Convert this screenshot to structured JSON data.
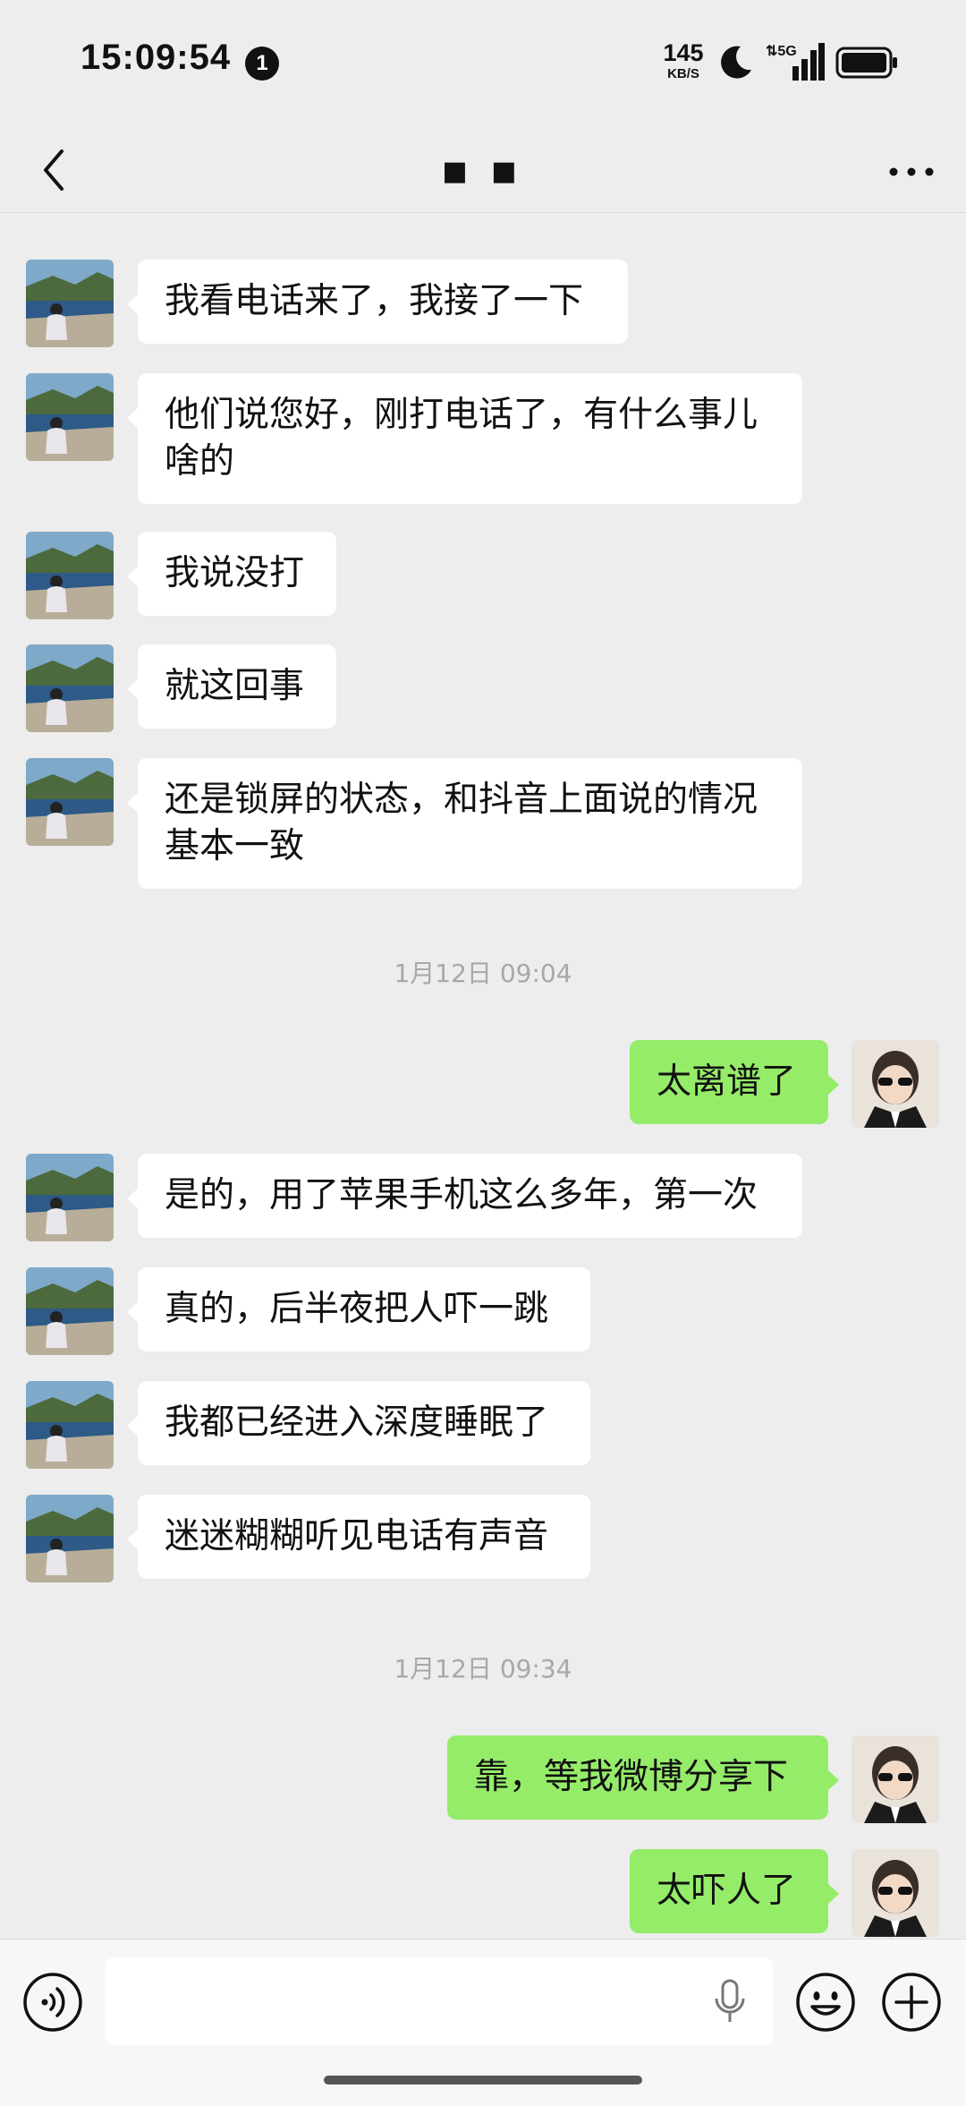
{
  "status_bar": {
    "time": "15:09:54",
    "notification_count": "1",
    "net_speed": "145",
    "net_speed_unit": "KB/S",
    "network": "5G"
  },
  "nav": {
    "title": "■ ■",
    "back_icon": "chevron-left-icon",
    "more_icon": "more-dots-icon"
  },
  "messages": [
    {
      "side": "in",
      "text": "我看电话来了，我接了一下"
    },
    {
      "side": "in",
      "text": "他们说您好，刚打电话了，有什么事儿啥的"
    },
    {
      "side": "in",
      "text": "我说没打"
    },
    {
      "side": "in",
      "text": "就这回事"
    },
    {
      "side": "in",
      "text": "还是锁屏的状态，和抖音上面说的情况基本一致"
    },
    {
      "side": "time",
      "text": "1月12日 09:04"
    },
    {
      "side": "out",
      "text": "太离谱了"
    },
    {
      "side": "in",
      "text": "是的，用了苹果手机这么多年，第一次"
    },
    {
      "side": "in",
      "text": "真的，后半夜把人吓一跳"
    },
    {
      "side": "in",
      "text": "我都已经进入深度睡眠了"
    },
    {
      "side": "in",
      "text": "迷迷糊糊听见电话有声音"
    },
    {
      "side": "time",
      "text": "1月12日 09:34"
    },
    {
      "side": "out",
      "text": "靠，等我微博分享下"
    },
    {
      "side": "out",
      "text": "太吓人了"
    }
  ],
  "input_bar": {
    "placeholder": "",
    "icons": [
      "voice-icon",
      "mic-icon",
      "emoji-icon",
      "plus-icon"
    ]
  },
  "colors": {
    "background": "#ededed",
    "incoming_bubble": "#ffffff",
    "outgoing_bubble": "#95ec69",
    "timestamp": "#a8a8a8"
  }
}
